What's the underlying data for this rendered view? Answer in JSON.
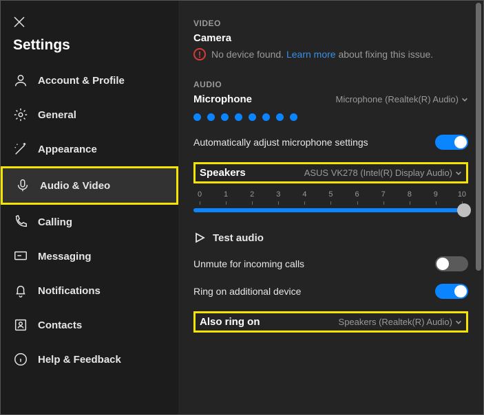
{
  "title": "Settings",
  "sidebar": {
    "items": [
      {
        "label": "Account & Profile"
      },
      {
        "label": "General"
      },
      {
        "label": "Appearance"
      },
      {
        "label": "Audio & Video"
      },
      {
        "label": "Calling"
      },
      {
        "label": "Messaging"
      },
      {
        "label": "Notifications"
      },
      {
        "label": "Contacts"
      },
      {
        "label": "Help & Feedback"
      }
    ]
  },
  "video": {
    "section_label": "VIDEO",
    "heading": "Camera",
    "error_prefix": "No device found.",
    "learn_more": "Learn more",
    "error_suffix": "about fixing this issue."
  },
  "audio": {
    "section_label": "AUDIO",
    "mic_heading": "Microphone",
    "mic_device": "Microphone (Realtek(R) Audio)",
    "auto_adjust_label": "Automatically adjust microphone settings",
    "speakers_heading": "Speakers",
    "speakers_device": "ASUS VK278 (Intel(R) Display Audio)",
    "slider_ticks": [
      "0",
      "1",
      "2",
      "3",
      "4",
      "5",
      "6",
      "7",
      "8",
      "9",
      "10"
    ],
    "test_audio_label": "Test audio",
    "unmute_label": "Unmute for incoming calls",
    "ring_additional_label": "Ring on additional device",
    "also_ring_heading": "Also ring on",
    "also_ring_device": "Speakers (Realtek(R) Audio)"
  }
}
